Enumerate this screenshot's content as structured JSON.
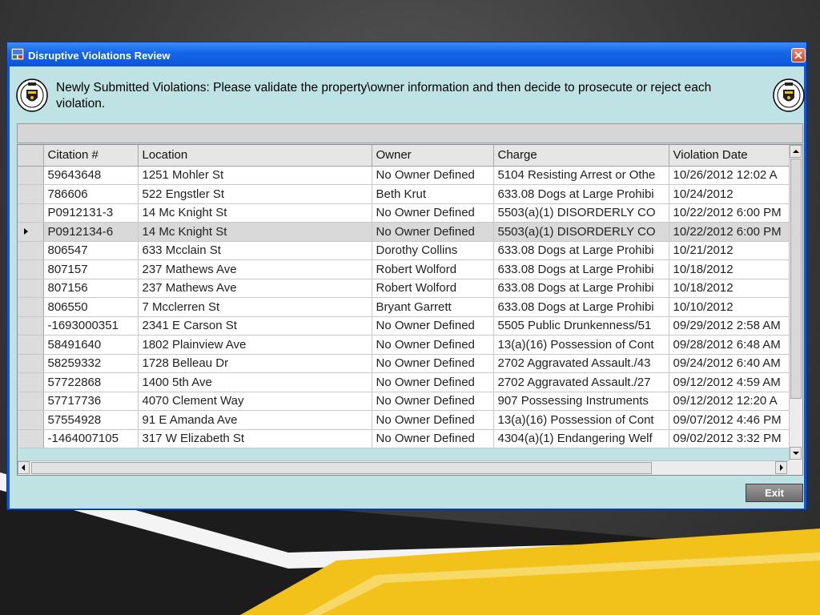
{
  "window": {
    "title": "Disruptive Violations Review",
    "instructions": "Newly Submitted Violations:  Please validate the property\\owner information and then decide to prosecute or reject each violation."
  },
  "grid": {
    "columns": [
      "Citation #",
      "Location",
      "Owner",
      "Charge",
      "Violation Date"
    ],
    "selected_row": 3,
    "rows": [
      [
        "59643648",
        "1251 Mohler St",
        "No Owner Defined",
        "5104 Resisting Arrest or Othe",
        "10/26/2012 12:02 A"
      ],
      [
        "786606",
        "522 Engstler St",
        "Beth  Krut",
        "633.08 Dogs at Large Prohibi",
        "10/24/2012"
      ],
      [
        "P0912131-3",
        "14 Mc Knight St",
        "No Owner Defined",
        "5503(a)(1) DISORDERLY CO",
        "10/22/2012 6:00 PM"
      ],
      [
        "P0912134-6",
        "14 Mc Knight St",
        "No Owner Defined",
        "5503(a)(1) DISORDERLY CO",
        "10/22/2012 6:00 PM"
      ],
      [
        "806547",
        "633 Mcclain St",
        "Dorothy  Collins",
        "633.08 Dogs at Large Prohibi",
        "10/21/2012"
      ],
      [
        "807157",
        "237 Mathews Ave",
        "Robert  Wolford",
        "633.08 Dogs at Large Prohibi",
        "10/18/2012"
      ],
      [
        "807156",
        "237 Mathews Ave",
        "Robert  Wolford",
        "633.08 Dogs at Large Prohibi",
        "10/18/2012"
      ],
      [
        "806550",
        "7 Mcclerren St",
        "Bryant  Garrett",
        "633.08 Dogs at Large Prohibi",
        "10/10/2012"
      ],
      [
        "-1693000351",
        "2341 E Carson St",
        "No Owner Defined",
        "5505 Public Drunkenness/51",
        "09/29/2012 2:58 AM"
      ],
      [
        "58491640",
        "1802 Plainview Ave",
        "No Owner Defined",
        "13(a)(16) Possession of Cont",
        "09/28/2012 6:48 AM"
      ],
      [
        "58259332",
        "1728 Belleau Dr",
        "No Owner Defined",
        "2702 Aggravated Assault./43",
        "09/24/2012 6:40 AM"
      ],
      [
        "57722868",
        "1400 5th Ave",
        "No Owner Defined",
        "2702 Aggravated Assault./27",
        "09/12/2012 4:59 AM"
      ],
      [
        "57717736",
        "4070 Clement Way",
        "No Owner Defined",
        "907 Possessing Instruments",
        "09/12/2012 12:20 A"
      ],
      [
        "57554928",
        "91 E Amanda Ave",
        "No Owner Defined",
        "13(a)(16) Possession of Cont",
        "09/07/2012 4:46 PM"
      ],
      [
        "-1464007105",
        "317 W Elizabeth St",
        "No Owner Defined",
        "4304(a)(1) Endangering Welf",
        "09/02/2012 3:32 PM"
      ]
    ]
  },
  "buttons": {
    "exit": "Exit"
  },
  "colors": {
    "titlebar": "#0a55d8",
    "client_bg": "#bfe3e4",
    "slide_accent": "#f2c21a",
    "close_button": "#d6431d"
  }
}
